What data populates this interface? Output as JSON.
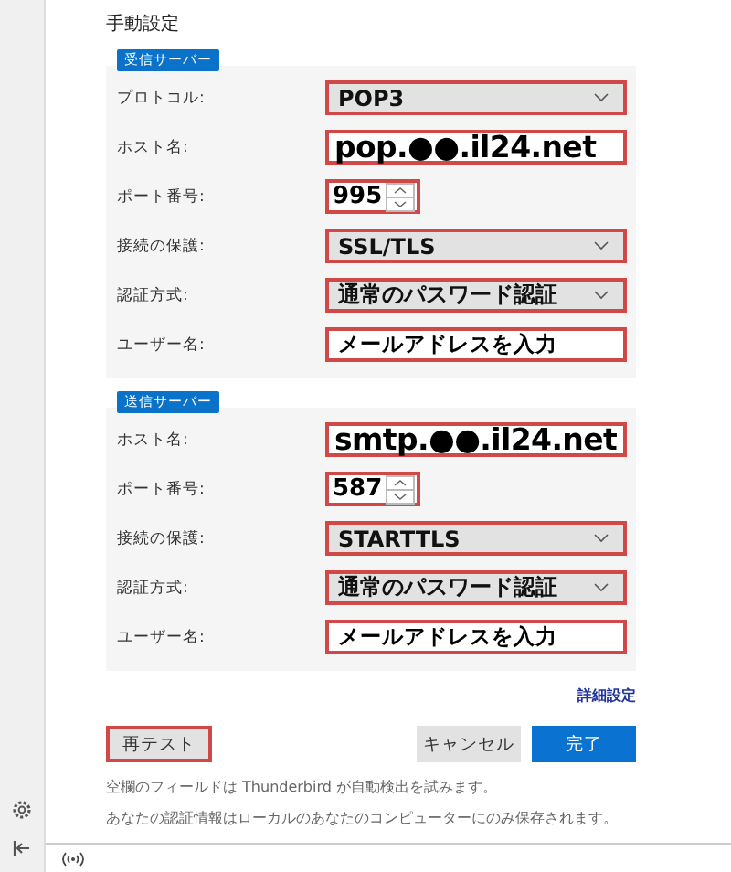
{
  "title": "手動設定",
  "incoming": {
    "badge": "受信サーバー",
    "rows": [
      {
        "label": "プロトコル:",
        "kind": "select",
        "value": "POP3",
        "highlighted": true
      },
      {
        "label": "ホスト名:",
        "kind": "host",
        "value": "pop.●●.il24.net",
        "highlighted": true
      },
      {
        "label": "ポート番号:",
        "kind": "port",
        "value": "995",
        "highlighted": true
      },
      {
        "label": "接続の保護:",
        "kind": "select",
        "value": "SSL/TLS",
        "highlighted": true
      },
      {
        "label": "認証方式:",
        "kind": "select",
        "value": "通常のパスワード認証",
        "highlighted": true
      },
      {
        "label": "ユーザー名:",
        "kind": "text",
        "value": "メールアドレスを入力",
        "highlighted": true
      }
    ]
  },
  "outgoing": {
    "badge": "送信サーバー",
    "rows": [
      {
        "label": "ホスト名:",
        "kind": "host",
        "value": "smtp.●●.il24.net",
        "highlighted": true
      },
      {
        "label": "ポート番号:",
        "kind": "port",
        "value": "587",
        "highlighted": true
      },
      {
        "label": "接続の保護:",
        "kind": "select",
        "value": "STARTTLS",
        "highlighted": true
      },
      {
        "label": "認証方式:",
        "kind": "select",
        "value": "通常のパスワード認証",
        "highlighted": true
      },
      {
        "label": "ユーザー名:",
        "kind": "text",
        "value": "メールアドレスを入力",
        "highlighted": true
      }
    ]
  },
  "advanced_link": "詳細設定",
  "buttons": [
    {
      "label": "再テスト",
      "kind": "default",
      "highlighted": true
    },
    {
      "label": "キャンセル",
      "kind": "default",
      "highlighted": false
    },
    {
      "label": "完了",
      "kind": "primary",
      "highlighted": false
    }
  ],
  "notes": [
    "空欄のフィールドは Thunderbird が自動検出を試みます。",
    "あなたの認証情報はローカルのあなたのコンピューターにのみ保存されます。"
  ]
}
